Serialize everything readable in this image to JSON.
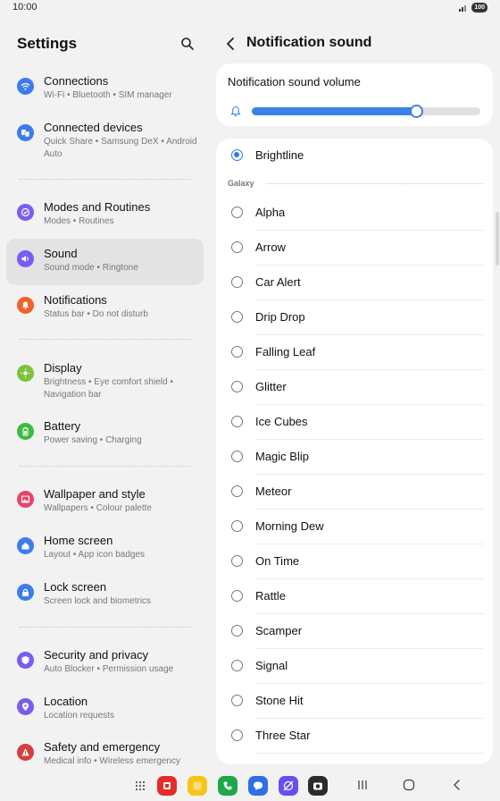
{
  "status": {
    "time": "10:00",
    "battery": "100"
  },
  "left": {
    "title": "Settings",
    "items": [
      {
        "label": "Connections",
        "sub": "Wi-Fi  •  Bluetooth  •  SIM manager",
        "icon": "wifi-icon",
        "color": "#3e7bf0"
      },
      {
        "label": "Connected devices",
        "sub": "Quick Share  •  Samsung DeX  •  Android Auto",
        "icon": "devices-icon",
        "color": "#3e7bf0"
      },
      {
        "label": "Modes and Routines",
        "sub": "Modes  •  Routines",
        "icon": "modes-icon",
        "color": "#7a5cf2"
      },
      {
        "label": "Sound",
        "sub": "Sound mode  •  Ringtone",
        "icon": "sound-icon",
        "color": "#7a5cf2"
      },
      {
        "label": "Notifications",
        "sub": "Status bar  •  Do not disturb",
        "icon": "bell-icon",
        "color": "#f0622b"
      },
      {
        "label": "Display",
        "sub": "Brightness  •  Eye comfort shield  •  Navigation bar",
        "icon": "sun-icon",
        "color": "#7cc23b"
      },
      {
        "label": "Battery",
        "sub": "Power saving  •  Charging",
        "icon": "battery-icon",
        "color": "#3fba45"
      },
      {
        "label": "Wallpaper and style",
        "sub": "Wallpapers  •  Colour palette",
        "icon": "wallpaper-icon",
        "color": "#e8456a"
      },
      {
        "label": "Home screen",
        "sub": "Layout  •  App icon badges",
        "icon": "home-icon",
        "color": "#3e7bf0"
      },
      {
        "label": "Lock screen",
        "sub": "Screen lock and biometrics",
        "icon": "lock-icon",
        "color": "#3e7bf0"
      },
      {
        "label": "Security and privacy",
        "sub": "Auto Blocker  •  Permission usage",
        "icon": "shield-icon",
        "color": "#7a5cf2"
      },
      {
        "label": "Location",
        "sub": "Location requests",
        "icon": "location-icon",
        "color": "#7a5cf2"
      },
      {
        "label": "Safety and emergency",
        "sub": "Medical info  •  Wireless emergency alerts",
        "icon": "emergency-icon",
        "color": "#d83d3d"
      }
    ]
  },
  "right": {
    "title": "Notification sound",
    "volume_label": "Notification sound volume",
    "volume_fraction": 0.72,
    "selected": "Brightline",
    "group_header": "Galaxy",
    "sounds": [
      "Alpha",
      "Arrow",
      "Car Alert",
      "Drip Drop",
      "Falling Leaf",
      "Glitter",
      "Ice Cubes",
      "Magic Blip",
      "Meteor",
      "Morning Dew",
      "On Time",
      "Rattle",
      "Scamper",
      "Signal",
      "Stone Hit",
      "Three Star",
      "Three Star"
    ]
  },
  "dock": {
    "apps": [
      {
        "icon": "flipboard-icon",
        "color": "#e52b2b"
      },
      {
        "icon": "notes-icon",
        "color": "#f5c518"
      },
      {
        "icon": "phone-icon",
        "color": "#1fa84a"
      },
      {
        "icon": "messages-icon",
        "color": "#2f6fe6"
      },
      {
        "icon": "browser-icon",
        "color": "#6a4cf0"
      },
      {
        "icon": "camera-icon",
        "color": "#2b2b2b"
      }
    ]
  }
}
